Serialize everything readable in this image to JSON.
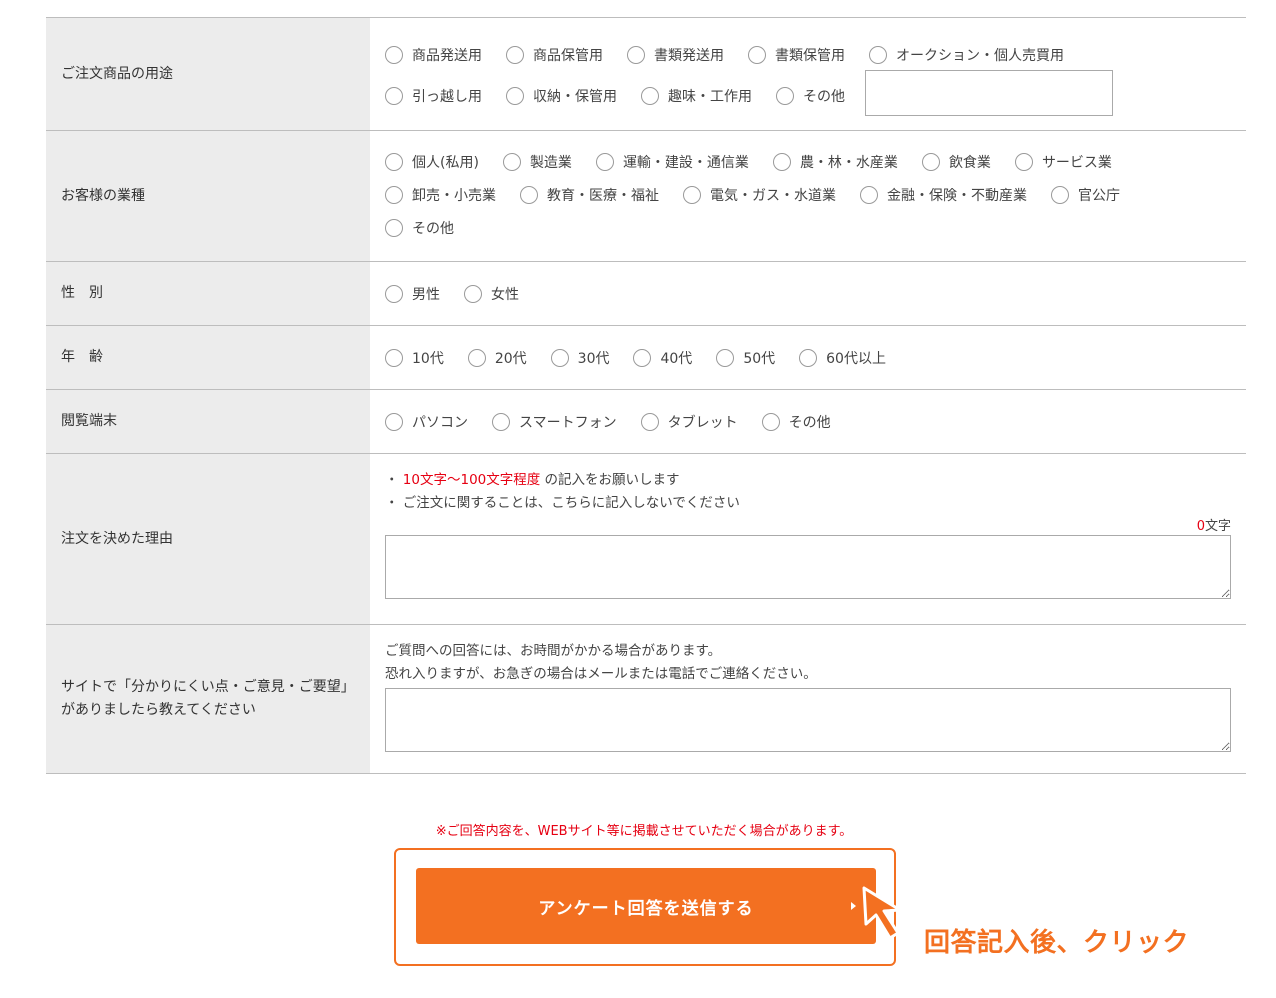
{
  "usage": {
    "label": "ご注文商品の用途",
    "line1": [
      "商品発送用",
      "商品保管用",
      "書類発送用",
      "書類保管用",
      "オークション・個人売買用"
    ],
    "line2": [
      "引っ越し用",
      "収納・保管用",
      "趣味・工作用",
      "その他"
    ],
    "other_value": ""
  },
  "business": {
    "label": "お客様の業種",
    "line1": [
      "個人(私用)",
      "製造業",
      "運輸・建設・通信業",
      "農・林・水産業",
      "飲食業",
      "サービス業"
    ],
    "line2": [
      "卸売・小売業",
      "教育・医療・福祉",
      "電気・ガス・水道業",
      "金融・保険・不動産業",
      "官公庁"
    ],
    "line3": [
      "その他"
    ]
  },
  "gender": {
    "label": "性　別",
    "options": [
      "男性",
      "女性"
    ]
  },
  "age": {
    "label": "年　齢",
    "options": [
      "10代",
      "20代",
      "30代",
      "40代",
      "50代",
      "60代以上"
    ]
  },
  "device": {
    "label": "閲覧端末",
    "options": [
      "パソコン",
      "スマートフォン",
      "タブレット",
      "その他"
    ]
  },
  "reason": {
    "label": "注文を決めた理由",
    "note1_bullet": "・",
    "note1_red": "10文字～100文字程度",
    "note1_rest": "の記入をお願いします",
    "note2": "・ ご注文に関することは、こちらに記入しないでください",
    "counter_value": "0",
    "counter_unit": "文字",
    "text_value": ""
  },
  "site": {
    "label_line1": "サイトで「分かりにくい点・ご意見・ご要望」",
    "label_line2": "がありましたら教えてください",
    "msg1": "ご質問への回答には、お時間がかかる場合があります。",
    "msg2": "恐れ入りますが、お急ぎの場合はメールまたは電話でご連絡ください。",
    "text_value": ""
  },
  "footer": {
    "disclaimer": "※ご回答内容を、WEBサイト等に掲載させていただく場合があります。",
    "submit_label": "アンケート回答を送信する",
    "annotation": "回答記入後、クリック"
  },
  "colors": {
    "accent": "#f37021",
    "warning_red": "#e60012",
    "label_bg": "#ececec",
    "border": "#bdbdbd"
  },
  "icons": {
    "radio": "radio-unchecked-icon",
    "cursor": "mouse-pointer-icon",
    "submit_arrow": "triangle-right-icon"
  }
}
